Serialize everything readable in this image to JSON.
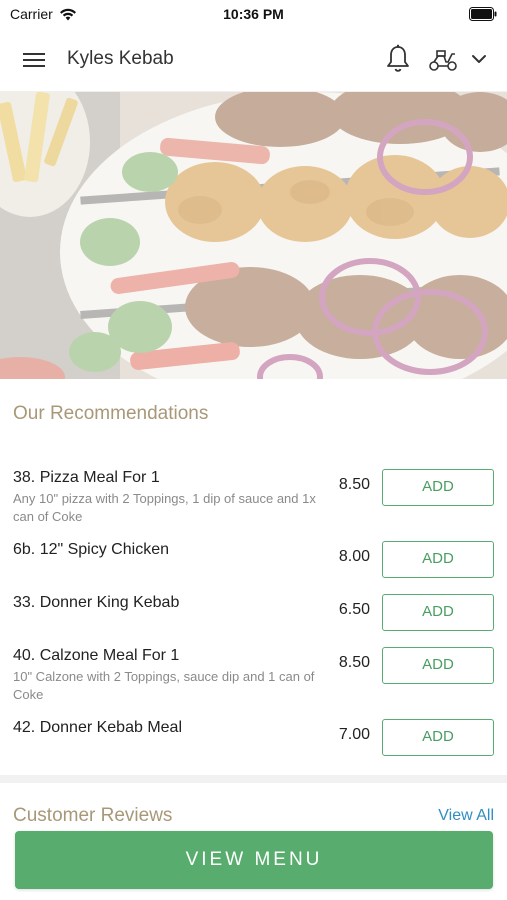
{
  "status_bar": {
    "carrier": "Carrier",
    "time": "10:36 PM"
  },
  "header": {
    "title": "Kyles Kebab",
    "menu_icon": "hamburger-menu-icon",
    "notification_icon": "bell-icon",
    "delivery_icon": "scooter-icon",
    "dropdown_icon": "chevron-down-icon"
  },
  "recommendations": {
    "title": "Our Recommendations",
    "add_label": "ADD",
    "items": [
      {
        "name": "38. Pizza Meal For 1",
        "description": "Any 10\" pizza with 2 Toppings, 1 dip of sauce and 1x can of Coke",
        "price": "8.50"
      },
      {
        "name": "6b. 12\" Spicy Chicken",
        "description": "",
        "price": "8.00"
      },
      {
        "name": "33. Donner King Kebab",
        "description": "",
        "price": "6.50"
      },
      {
        "name": "40. Calzone Meal For 1",
        "description": "10\" Calzone with 2 Toppings, sauce dip and 1 can of Coke",
        "price": "8.50"
      },
      {
        "name": "42. Donner Kebab Meal",
        "description": "",
        "price": "7.00"
      }
    ]
  },
  "reviews": {
    "title": "Customer Reviews",
    "view_all": "View All"
  },
  "footer": {
    "view_menu": "VIEW MENU"
  },
  "colors": {
    "accent_green": "#58ac6e",
    "section_title": "#a89878",
    "link_blue": "#2f8fc4"
  }
}
